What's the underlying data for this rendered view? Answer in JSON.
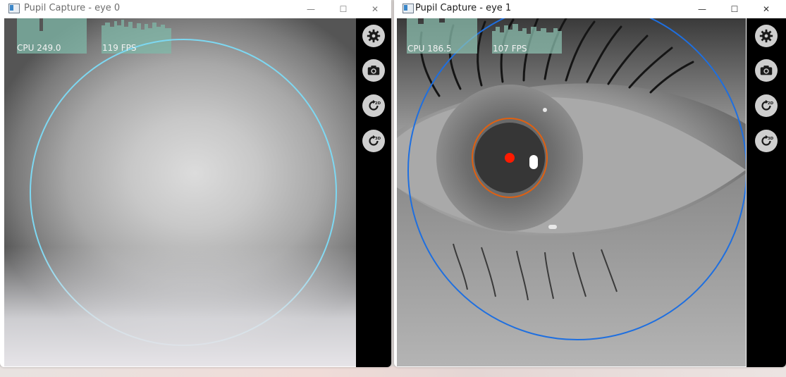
{
  "windows": [
    {
      "title": "Pupil Capture - eye 0",
      "cpu_label": "CPU 249.0",
      "fps_label": "119 FPS",
      "detection_color": "#7dd8f2",
      "buttons": [
        "settings-icon",
        "camera-icon",
        "restart-2d-icon",
        "restart-3d-icon"
      ]
    },
    {
      "title": "Pupil Capture - eye 1",
      "cpu_label": "CPU 186.5",
      "fps_label": "107 FPS",
      "detection_color": "#1e6fe0",
      "pupil_outline_color": "#e06010",
      "pupil_center_color": "#ff1a00",
      "buttons": [
        "settings-icon",
        "camera-icon",
        "restart-2d-icon",
        "restart-3d-icon"
      ]
    }
  ],
  "controls": {
    "minimize": "—",
    "maximize": "☐",
    "close": "✕"
  },
  "sidebar_badges": {
    "twod": "2D",
    "threed": "3D"
  }
}
